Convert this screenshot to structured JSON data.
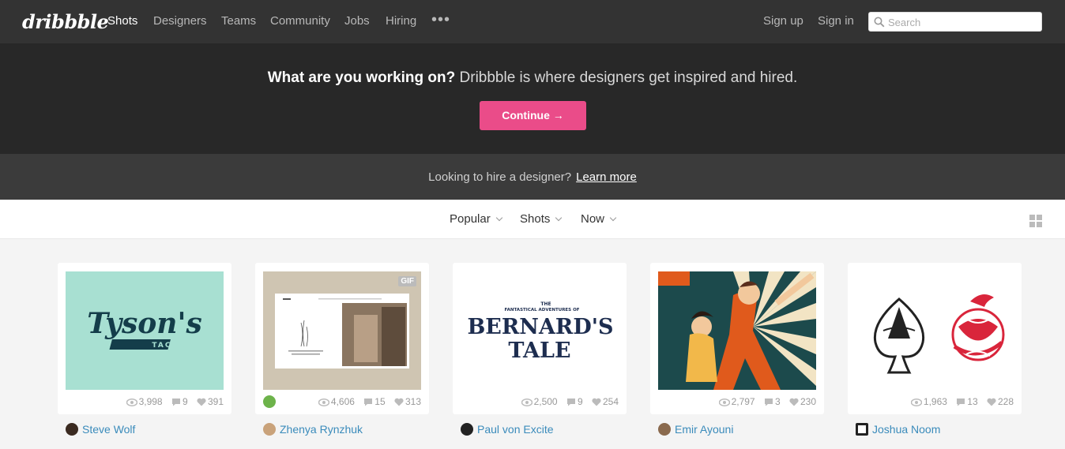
{
  "nav": {
    "logo": "dribbble",
    "items": [
      "Shots",
      "Designers",
      "Teams",
      "Community",
      "Jobs",
      "Hiring"
    ],
    "more": "•••",
    "signup": "Sign up",
    "signin": "Sign in",
    "search_placeholder": "Search"
  },
  "banner": {
    "question": "What are you working on?",
    "statement": "Dribbble is where designers get inspired and hired.",
    "button": "Continue →"
  },
  "hire": {
    "text": "Looking to hire a designer?",
    "link": "Learn more"
  },
  "filters": [
    "Popular",
    "Shots",
    "Now"
  ],
  "shots": [
    {
      "views": "3,998",
      "comments": "9",
      "likes": "391",
      "author": "Steve Wolf",
      "art_text": "Tyson's",
      "art_sub": "TACOS"
    },
    {
      "views": "4,606",
      "comments": "15",
      "likes": "313",
      "author": "Zhenya Rynzhuk",
      "badge": "GIF"
    },
    {
      "views": "2,500",
      "comments": "9",
      "likes": "254",
      "author": "Paul von Excite",
      "art_small": "THE",
      "art_mid": "FANTASTICAL ADVENTURES OF",
      "art_l1": "BERNARD'S",
      "art_l2": "TALE"
    },
    {
      "views": "2,797",
      "comments": "3",
      "likes": "230",
      "author": "Emir Ayouni"
    },
    {
      "views": "1,963",
      "comments": "13",
      "likes": "228",
      "author": "Joshua Noom"
    }
  ],
  "colors": {
    "nav_bg": "#333333",
    "banner_bg": "#282828",
    "hire_bg": "#3b3b3b",
    "accent": "#ea4c89",
    "link": "#3a8bbb"
  }
}
